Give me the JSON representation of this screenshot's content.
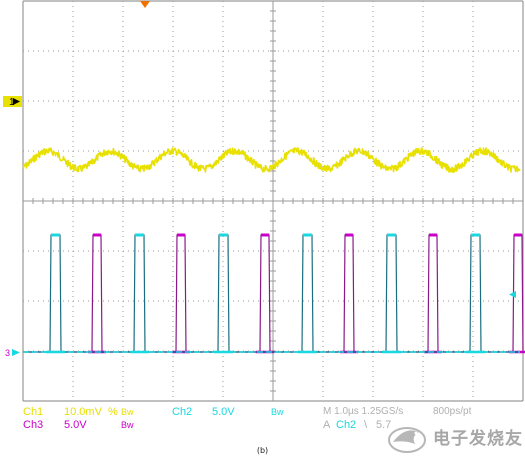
{
  "colors": {
    "ch1": "#e8e000",
    "ch2": "#18d8e0",
    "ch3": "#c800c8",
    "ch2_dark": "#1a6e80",
    "ch3_dark": "#8a1a8a",
    "grid": "#9a9a9a",
    "trigger": "#f07000",
    "status_text_dim": "#b0b0b0"
  },
  "markers": {
    "ch1_label": "1",
    "ch3_label": "3",
    "trigger_icon": "triangle-down",
    "ch1_marker_icon": "arrow-right",
    "ch3_marker_icon": "arrow-right",
    "ch2_level_icon": "arrow-left"
  },
  "status": {
    "ch1": {
      "name": "Ch1",
      "scale": "10.0mV",
      "coupling": "%",
      "bw": "Bw"
    },
    "ch2": {
      "name": "Ch2",
      "scale": "5.0V",
      "bw": "Bw"
    },
    "ch3": {
      "name": "Ch3",
      "scale": "5.0V",
      "bw": "Bw"
    },
    "timebase": {
      "label": "M 1.0µs 1.25GS/s",
      "points": "800ps/pt"
    },
    "trigger": {
      "mode": "A",
      "source": "Ch2",
      "slope": "\\",
      "level": "5.7"
    }
  },
  "caption": "(b)",
  "watermark": {
    "text": "电子发烧友",
    "icon": "bird-logo-icon"
  },
  "waveform": {
    "ch1_ripple_periods": 8,
    "pulse_count": 12
  }
}
